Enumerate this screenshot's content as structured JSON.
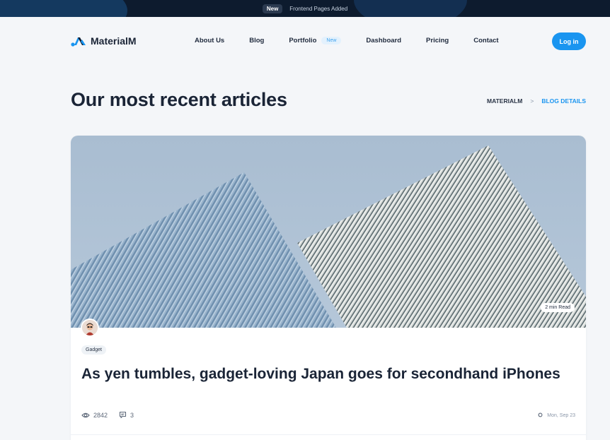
{
  "announcement": {
    "badge": "New",
    "message": "Frontend Pages Added"
  },
  "brand": {
    "name": "MaterialM",
    "accent": "#1a95f0"
  },
  "nav": {
    "items": [
      {
        "label": "About Us"
      },
      {
        "label": "Blog"
      },
      {
        "label": "Portfolio",
        "badge": "New"
      },
      {
        "label": "Dashboard"
      },
      {
        "label": "Pricing"
      },
      {
        "label": "Contact"
      }
    ],
    "login_label": "Log in"
  },
  "page": {
    "title": "Our most recent articles",
    "breadcrumb": {
      "home": "MATERIALM",
      "separator": ">",
      "current": "BLOG DETAILS"
    }
  },
  "article": {
    "read_time": "2 min Read",
    "category": "Gadget",
    "title": "As yen tumbles, gadget-loving Japan goes for secondhand iPhones",
    "views": "2842",
    "comments": "3",
    "date": "Mon, Sep 23"
  },
  "icons": {
    "logo": "materialm-logo-icon",
    "views": "eye-icon",
    "comments": "comment-icon",
    "date": "circle-dot-icon"
  }
}
